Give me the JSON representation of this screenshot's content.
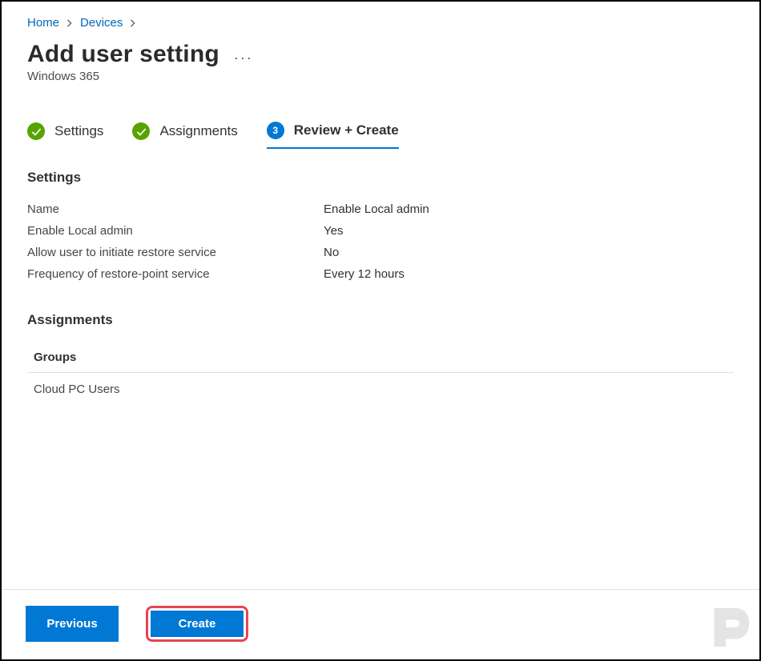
{
  "breadcrumb": {
    "items": [
      {
        "label": "Home"
      },
      {
        "label": "Devices"
      }
    ]
  },
  "header": {
    "title": "Add user setting",
    "subtitle": "Windows 365"
  },
  "steps": [
    {
      "label": "Settings",
      "state": "done"
    },
    {
      "label": "Assignments",
      "state": "done"
    },
    {
      "label": "Review + Create",
      "state": "current",
      "number": "3"
    }
  ],
  "sections": {
    "settings": {
      "heading": "Settings",
      "rows": [
        {
          "key": "Name",
          "value": "Enable Local admin"
        },
        {
          "key": "Enable Local admin",
          "value": "Yes"
        },
        {
          "key": "Allow user to initiate restore service",
          "value": "No"
        },
        {
          "key": "Frequency of restore-point service",
          "value": "Every 12 hours"
        }
      ]
    },
    "assignments": {
      "heading": "Assignments",
      "table": {
        "header": "Groups",
        "rows": [
          {
            "value": "Cloud PC Users"
          }
        ]
      }
    }
  },
  "footer": {
    "previous": "Previous",
    "create": "Create"
  }
}
